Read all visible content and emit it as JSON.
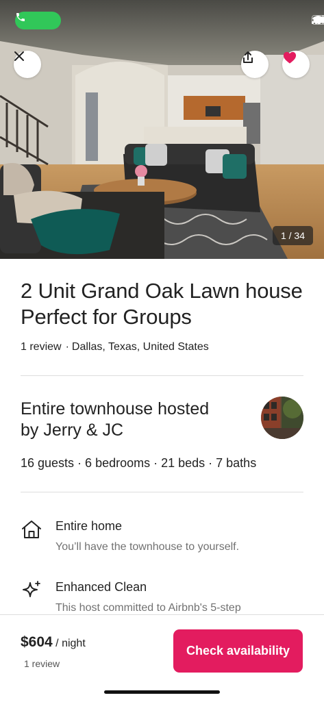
{
  "status_bar": {
    "call_icon": "phone-icon",
    "signal_icon": "cellular-signal-icon",
    "wifi_icon": "wifi-icon",
    "battery_icon": "battery-icon"
  },
  "hero": {
    "photo": "living-room-photo",
    "close_icon": "close-icon",
    "share_icon": "share-icon",
    "save_icon": "heart-icon",
    "save_color": "#e31c5f",
    "photo_counter": "1 / 34"
  },
  "listing": {
    "title": "2 Unit Grand Oak Lawn house Perfect for Groups",
    "reviews": "1 review",
    "separator": "·",
    "location": "Dallas, Texas, United States"
  },
  "host": {
    "title": "Entire townhouse hosted by Jerry & JC",
    "specs": "16 guests · 6 bedrooms · 21 beds · 7 baths",
    "avatar": "host-avatar"
  },
  "features": [
    {
      "icon": "home-icon",
      "title": "Entire home",
      "description": "You’ll have the townhouse to yourself."
    },
    {
      "icon": "sparkle-icon",
      "title": "Enhanced Clean",
      "description": "This host committed to Airbnb's 5-step"
    }
  ],
  "footer": {
    "price": "$604",
    "per": "/ night",
    "reviews": "1 review",
    "cta": "Check availability",
    "cta_color": "#e31c5f"
  }
}
